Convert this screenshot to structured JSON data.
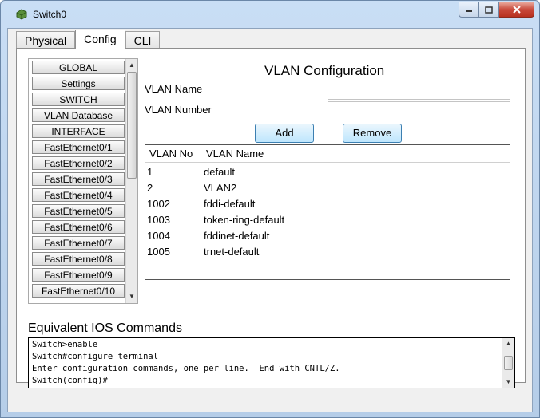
{
  "window": {
    "title": "Switch0",
    "buttons": {
      "minimize_icon": "minimize-icon",
      "maximize_icon": "maximize-icon",
      "close_icon": "close-icon"
    }
  },
  "tabs": [
    {
      "label": "Physical",
      "active": false
    },
    {
      "label": "Config",
      "active": true
    },
    {
      "label": "CLI",
      "active": false
    }
  ],
  "sidebar": {
    "items": [
      {
        "label": "GLOBAL"
      },
      {
        "label": "Settings"
      },
      {
        "label": "SWITCH"
      },
      {
        "label": "VLAN Database"
      },
      {
        "label": "INTERFACE"
      },
      {
        "label": "FastEthernet0/1"
      },
      {
        "label": "FastEthernet0/2"
      },
      {
        "label": "FastEthernet0/3"
      },
      {
        "label": "FastEthernet0/4"
      },
      {
        "label": "FastEthernet0/5"
      },
      {
        "label": "FastEthernet0/6"
      },
      {
        "label": "FastEthernet0/7"
      },
      {
        "label": "FastEthernet0/8"
      },
      {
        "label": "FastEthernet0/9"
      },
      {
        "label": "FastEthernet0/10"
      }
    ]
  },
  "vlan_config": {
    "title": "VLAN Configuration",
    "name_label": "VLAN Name",
    "name_value": "",
    "number_label": "VLAN Number",
    "number_value": "",
    "add_label": "Add",
    "remove_label": "Remove",
    "table": {
      "headers": [
        "VLAN No",
        "VLAN Name"
      ],
      "rows": [
        [
          "1",
          "default"
        ],
        [
          "2",
          "VLAN2"
        ],
        [
          "1002",
          "fddi-default"
        ],
        [
          "1003",
          "token-ring-default"
        ],
        [
          "1004",
          "fddinet-default"
        ],
        [
          "1005",
          "trnet-default"
        ]
      ]
    }
  },
  "ios": {
    "title": "Equivalent IOS Commands",
    "lines": [
      "Switch>enable",
      "Switch#configure terminal",
      "Enter configuration commands, one per line.  End with CNTL/Z.",
      "Switch(config)#"
    ]
  },
  "colors": {
    "title_bar": "#c9def5",
    "button_border": "#3c7fb1",
    "close_button": "#c8493a"
  }
}
